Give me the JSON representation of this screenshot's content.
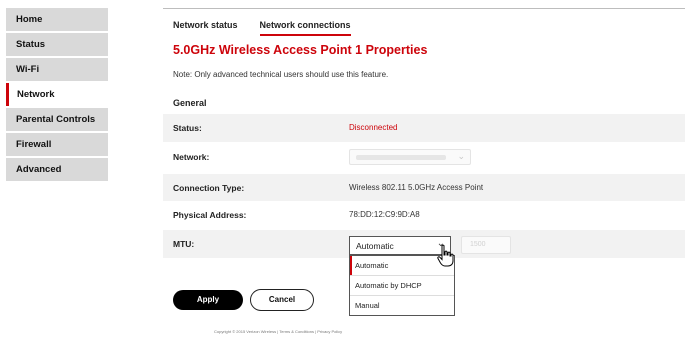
{
  "sidebar": {
    "items": [
      {
        "label": "Home"
      },
      {
        "label": "Status"
      },
      {
        "label": "Wi-Fi"
      },
      {
        "label": "Network",
        "active": true
      },
      {
        "label": "Parental Controls"
      },
      {
        "label": "Firewall"
      },
      {
        "label": "Advanced"
      }
    ]
  },
  "tabs": [
    {
      "label": "Network status"
    },
    {
      "label": "Network connections",
      "active": true
    }
  ],
  "page": {
    "title": "5.0GHz Wireless Access Point 1 Properties",
    "note": "Note: Only advanced technical users should use this feature.",
    "section": "General"
  },
  "fields": {
    "status": {
      "label": "Status:",
      "value": "Disconnected"
    },
    "network": {
      "label": "Network:"
    },
    "connection_type": {
      "label": "Connection Type:",
      "value": "Wireless 802.11 5.0GHz Access Point"
    },
    "physical_address": {
      "label": "Physical Address:",
      "value": "78:DD:12:C9:9D:A8"
    },
    "mtu": {
      "label": "MTU:",
      "selected": "Automatic",
      "input_placeholder": "1500"
    }
  },
  "mtu_options": [
    "Automatic",
    "Automatic by DHCP",
    "Manual"
  ],
  "buttons": {
    "apply": "Apply",
    "cancel": "Cancel"
  },
  "footer": "Copyright © 2015 Verizon Wireless | Terms & Conditions | Privacy Policy",
  "colors": {
    "accent": "#cd040b",
    "nav_bg": "#d9d9d9",
    "row_bg": "#f2f2f2"
  }
}
